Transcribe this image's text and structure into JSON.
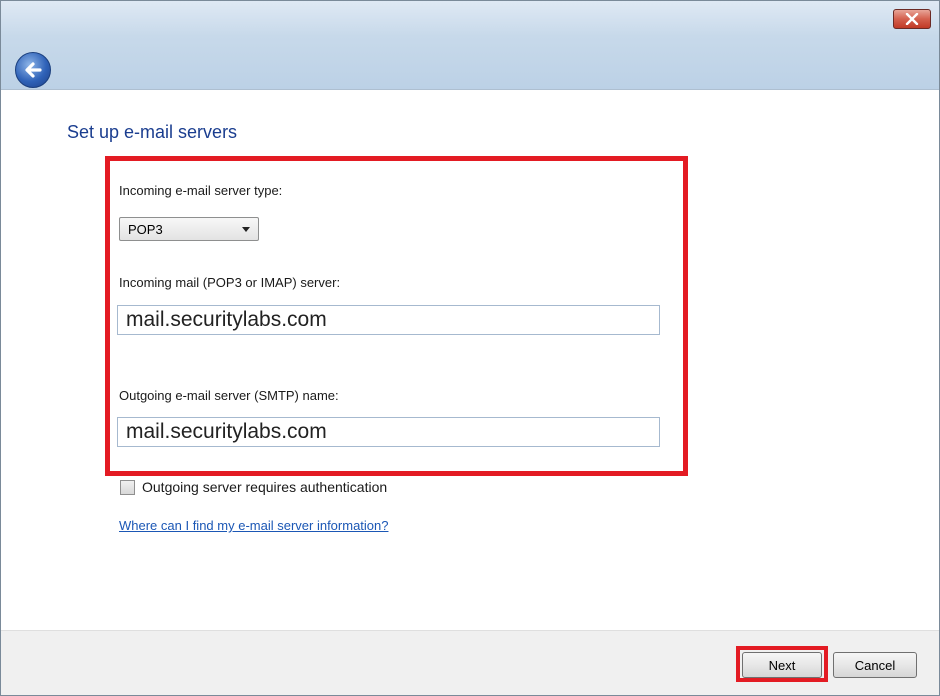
{
  "window": {
    "close_icon": "close-icon",
    "back_icon": "back-arrow-icon"
  },
  "main": {
    "heading": "Set up e-mail servers",
    "incoming_type_label": "Incoming e-mail server type:",
    "incoming_type_selected": "POP3",
    "incoming_server_label": "Incoming mail (POP3 or IMAP) server:",
    "incoming_server_value": "mail.securitylabs.com",
    "outgoing_server_label": "Outgoing e-mail server (SMTP) name:",
    "outgoing_server_value": "mail.securitylabs.com",
    "auth_checkbox_label": "Outgoing server requires authentication",
    "auth_checked": false,
    "help_link": "Where can I find my e-mail server information?"
  },
  "footer": {
    "next_label": "Next",
    "cancel_label": "Cancel"
  },
  "colors": {
    "heading": "#1a3d8f",
    "highlight": "#e31b23",
    "link": "#1b57b5"
  }
}
